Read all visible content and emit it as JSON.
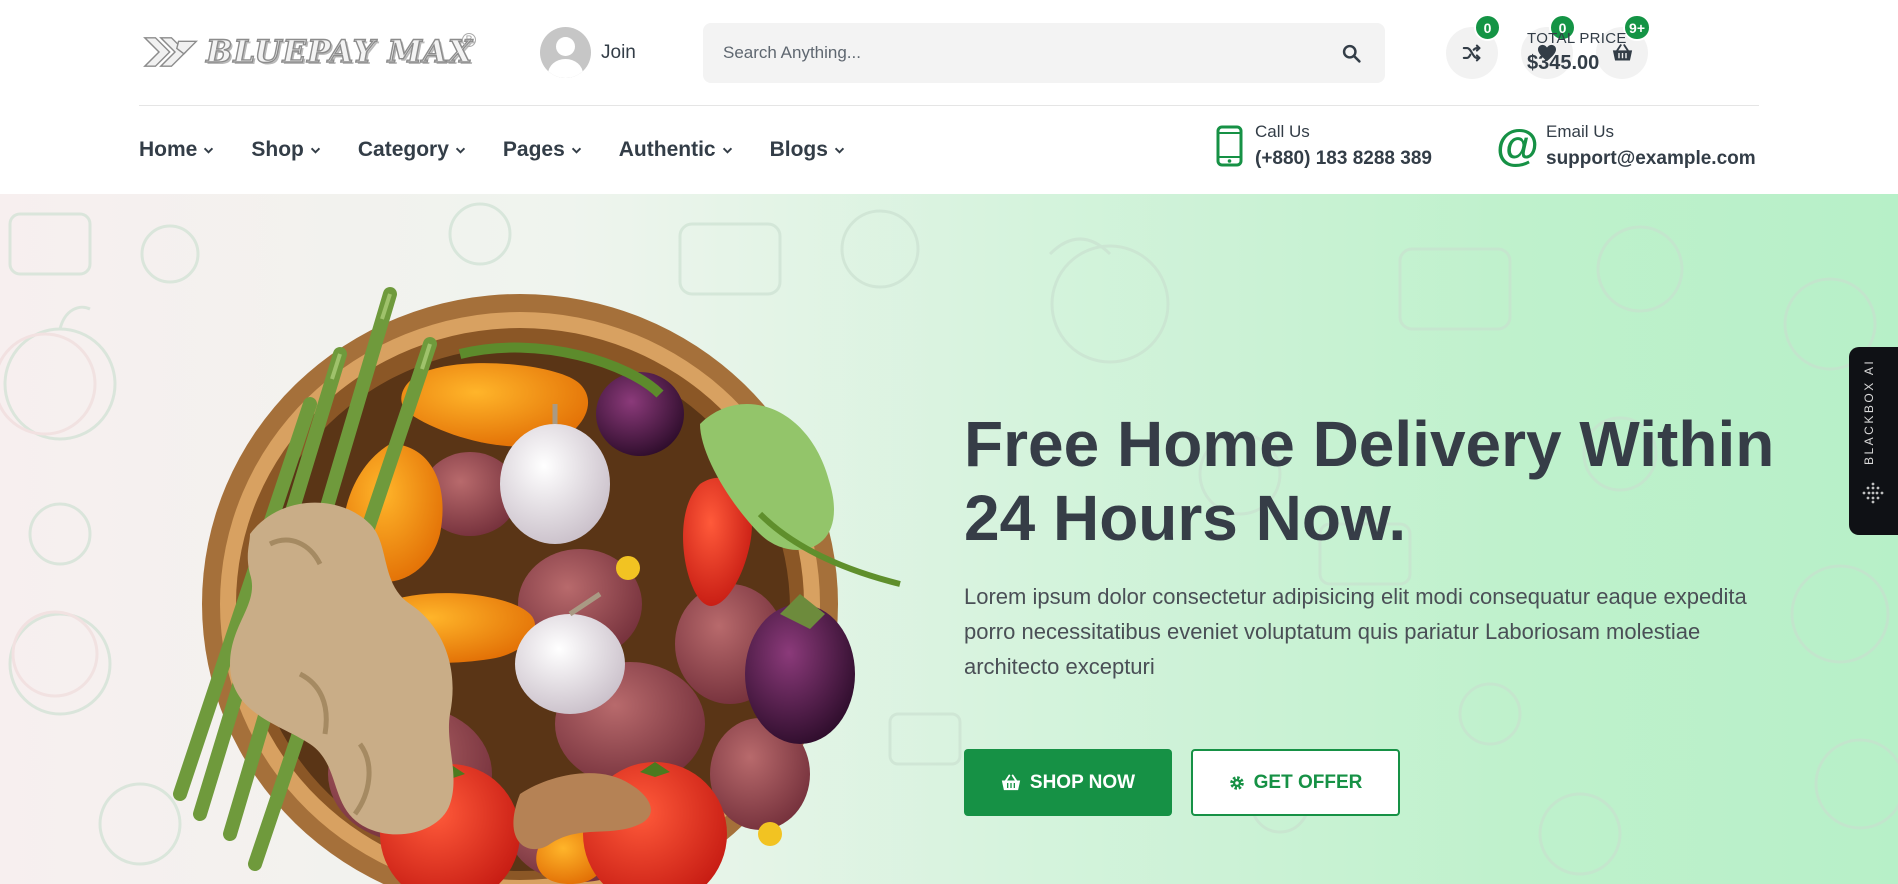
{
  "header": {
    "logo_text": "BLUEPAY MAX",
    "join_label": "Join",
    "search": {
      "placeholder": "Search Anything..."
    },
    "compare_count": "0",
    "wishlist_count": "0",
    "cart_count": "9+",
    "total_label": "TOTAL PRICE",
    "total_value": "$345.00"
  },
  "nav": {
    "items": [
      {
        "label": "Home"
      },
      {
        "label": "Shop"
      },
      {
        "label": "Category"
      },
      {
        "label": "Pages"
      },
      {
        "label": "Authentic"
      },
      {
        "label": "Blogs"
      }
    ]
  },
  "contact": {
    "call_label": "Call Us",
    "call_value": "(+880) 183 8288 389",
    "email_label": "Email Us",
    "email_value": "support@example.com"
  },
  "hero": {
    "title": "Free Home Delivery Within 24 Hours Now.",
    "text": "Lorem ipsum dolor consectetur adipisicing elit modi consequatur eaque expedita porro necessitatibus eveniet voluptatum quis pariatur Laboriosam molestiae architecto excepturi",
    "shop_button": "SHOP NOW",
    "offer_button": "GET OFFER"
  },
  "side_tab": {
    "label": "BLACKBOX AI"
  },
  "colors": {
    "brand_green": "#169145",
    "text_dark": "#333d47",
    "badge_green": "#149445"
  },
  "icons": [
    "search-icon",
    "shuffle-icon",
    "heart-icon",
    "basket-icon",
    "phone-icon",
    "at-icon",
    "gear-icon"
  ]
}
